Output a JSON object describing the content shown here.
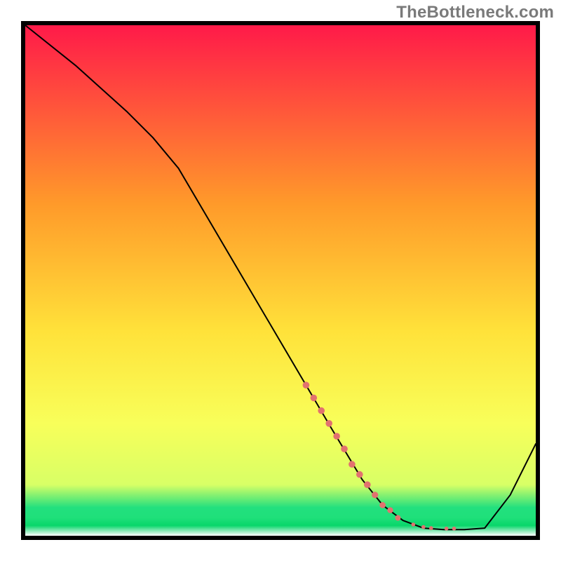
{
  "watermark": "TheBottleneck.com",
  "colors": {
    "border": "#000000",
    "curve": "#000000",
    "dots": "#e2726f",
    "gradient_top": "#ff1a49",
    "gradient_mid_upper": "#ff9a2a",
    "gradient_mid": "#ffe23a",
    "gradient_lower": "#f8ff5a",
    "gradient_green": "#22e07e",
    "gradient_bottom": "#08d66a",
    "gradient_base": "#ffffff"
  },
  "chart_data": {
    "type": "line",
    "title": "",
    "xlabel": "",
    "ylabel": "",
    "xlim": [
      0,
      100
    ],
    "ylim": [
      0,
      100
    ],
    "grid": false,
    "legend": false,
    "series": [
      {
        "name": "curve",
        "x": [
          0,
          10,
          20,
          25,
          30,
          40,
          50,
          60,
          66,
          70,
          74,
          78,
          82,
          86,
          90,
          95,
          100
        ],
        "values": [
          100,
          92,
          83,
          78,
          72,
          55,
          38,
          21,
          11,
          6,
          3,
          1.5,
          1.2,
          1.2,
          1.5,
          8,
          18
        ]
      }
    ],
    "highlight_dots": {
      "name": "marker-dots",
      "x": [
        55,
        56.5,
        58,
        59.5,
        61,
        62.5,
        64,
        65.5,
        67,
        68.5,
        70,
        71.5,
        73,
        76,
        78,
        79.5,
        82.5,
        84
      ],
      "values": [
        29.5,
        27,
        24.5,
        22,
        19.5,
        17,
        14,
        12,
        10,
        8,
        6,
        5,
        3.5,
        2.2,
        1.7,
        1.5,
        1.4,
        1.4
      ],
      "radius": [
        4.8,
        4.8,
        4.8,
        4.8,
        4.8,
        4.8,
        4.8,
        4.8,
        4.8,
        4.6,
        4.4,
        4.2,
        4.0,
        2.8,
        2.8,
        2.8,
        2.8,
        2.8
      ]
    }
  }
}
